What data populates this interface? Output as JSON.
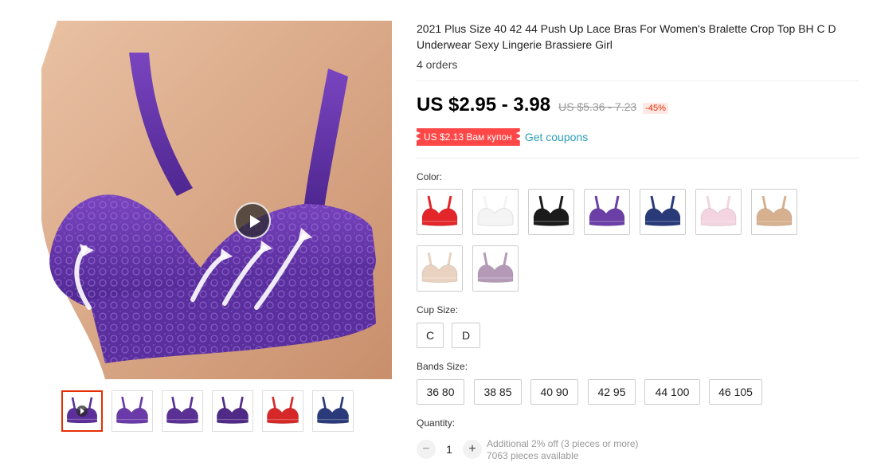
{
  "product": {
    "title": "2021 Plus Size 40 42 44 Push Up Lace Bras For Women's Bralette Crop Top BH C D Underwear Sexy Lingerie Brassiere Girl",
    "orders": "4 orders",
    "price": "US $2.95 - 3.98",
    "old_price": "US $5.36 - 7.23",
    "discount": "-45%",
    "coupon_label": "US $2.13 Вам купон",
    "get_coupons": "Get coupons"
  },
  "gallery": {
    "main_icon": "play-icon",
    "thumbnails": [
      {
        "color": "#5b2e99",
        "video": true
      },
      {
        "color": "#6a3aa8",
        "video": false
      },
      {
        "color": "#5a3094",
        "video": false
      },
      {
        "color": "#4f2a86",
        "video": false
      },
      {
        "color": "#d62828",
        "video": false
      },
      {
        "color": "#2a3a7a",
        "video": false
      }
    ]
  },
  "color": {
    "label": "Color:",
    "options": [
      {
        "name": "red",
        "hex": "#e3262a"
      },
      {
        "name": "white",
        "hex": "#f4f4f4"
      },
      {
        "name": "black",
        "hex": "#1b1b1b"
      },
      {
        "name": "purple",
        "hex": "#6b3fa6"
      },
      {
        "name": "navy",
        "hex": "#283a78"
      },
      {
        "name": "pink",
        "hex": "#f3d4e0"
      },
      {
        "name": "skin",
        "hex": "#d7b08f"
      },
      {
        "name": "beige",
        "hex": "#ead2c0"
      },
      {
        "name": "lilac",
        "hex": "#b59ab8"
      }
    ]
  },
  "cup_size": {
    "label": "Cup Size:",
    "options": [
      "C",
      "D"
    ]
  },
  "bands_size": {
    "label": "Bands Size:",
    "options": [
      "36 80",
      "38 85",
      "40 90",
      "42 95",
      "44 100",
      "46 105"
    ]
  },
  "quantity": {
    "label": "Quantity:",
    "minus": "−",
    "plus": "+",
    "value": "1",
    "note1": "Additional 2% off (3 pieces or more)",
    "note2": "7063 pieces available"
  },
  "colors": {
    "accent": "#e62e04",
    "coupon_bg": "#ff4747",
    "link": "#2a9fb6"
  }
}
